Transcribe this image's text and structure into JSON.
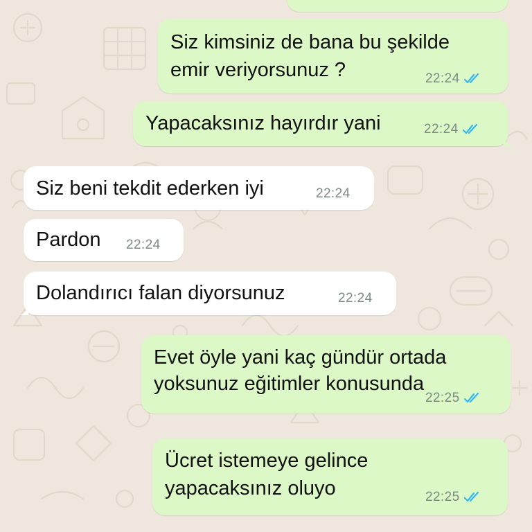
{
  "colors": {
    "wallpaper": "#efe7dd",
    "outgoing_bubble": "#dbf8c6",
    "incoming_bubble": "#ffffff",
    "read_ticks": "#34b7f1",
    "timestamp": "#7d8a83"
  },
  "status_icons": {
    "read": "double-check-icon"
  },
  "messages": [
    {
      "direction": "outgoing",
      "lines": [
        "Siz kimsiniz de bana bu şekilde",
        "emir veriyorsunuz ?"
      ],
      "time": "22:24",
      "status": "read"
    },
    {
      "direction": "outgoing",
      "lines": [
        "Yapacaksınız hayırdır yani"
      ],
      "time": "22:24",
      "status": "read"
    },
    {
      "direction": "incoming",
      "lines": [
        "Siz beni tekdit ederken iyi"
      ],
      "time": "22:24"
    },
    {
      "direction": "incoming",
      "lines": [
        "Pardon"
      ],
      "time": "22:24"
    },
    {
      "direction": "incoming",
      "lines": [
        "Dolandırıcı falan diyorsunuz"
      ],
      "time": "22:24"
    },
    {
      "direction": "outgoing",
      "lines": [
        "Evet öyle yani kaç gündür ortada",
        "yoksunuz eğitimler konusunda"
      ],
      "time": "22:25",
      "status": "read"
    },
    {
      "direction": "outgoing",
      "lines": [
        "Ücret istemeye gelince",
        "yapacaksınız oluyo"
      ],
      "time": "22:25",
      "status": "read"
    }
  ]
}
